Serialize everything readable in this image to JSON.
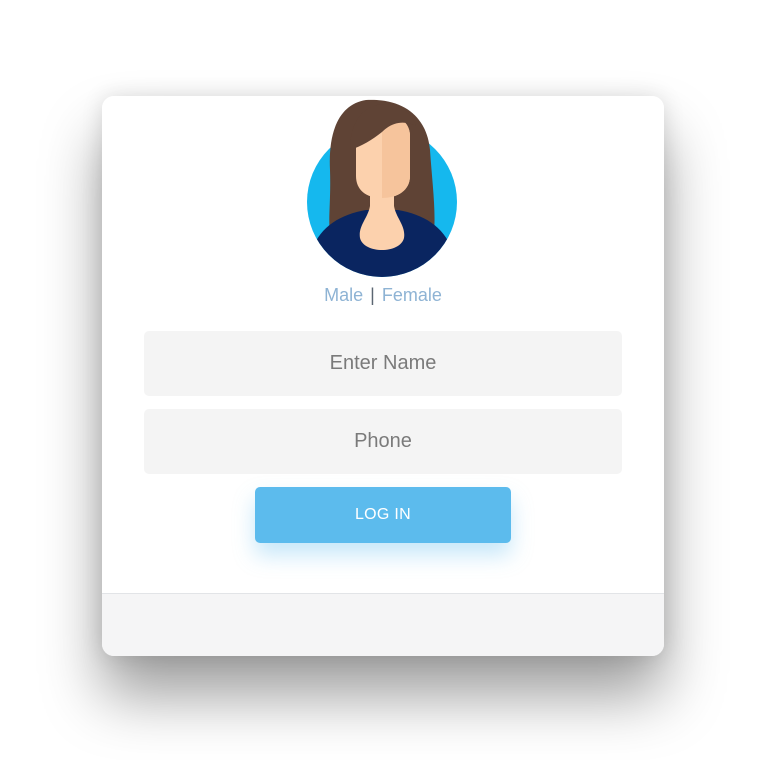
{
  "avatar": {
    "icon": "female-user-avatar-icon",
    "colors": {
      "circle": "#15b8ee",
      "hair": "#5f4335",
      "skin": "#fcd1ad",
      "skin_shade": "#f6c49c",
      "shirt": "#0a2560"
    }
  },
  "gender": {
    "male_label": "Male",
    "separator": "|",
    "female_label": "Female"
  },
  "form": {
    "name_placeholder": "Enter Name",
    "name_value": "",
    "phone_placeholder": "Phone",
    "phone_value": "",
    "login_label": "LOG IN"
  },
  "colors": {
    "accent": "#5cbbed",
    "link": "#8eb3d4",
    "field_bg": "#f4f4f4",
    "footer_bg": "#f5f5f6"
  }
}
